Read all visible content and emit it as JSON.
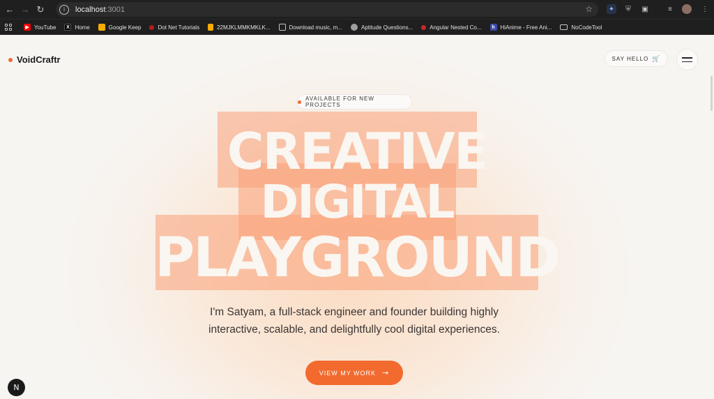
{
  "browser": {
    "url_host": "localhost",
    "url_port": ":3001",
    "bookmarks": [
      {
        "label": "YouTube",
        "icon": "youtube-icon",
        "color": "#ff0000"
      },
      {
        "label": "Home",
        "icon": "x-icon",
        "color": "#000000"
      },
      {
        "label": "Google Keep",
        "icon": "keep-icon",
        "color": "#f9ab00"
      },
      {
        "label": "Dot Net Tutorials",
        "icon": "dotnet-icon",
        "color": "#b71c1c"
      },
      {
        "label": "22MJKLMMKMKLK...",
        "icon": "file-icon",
        "color": "#f9ab00"
      },
      {
        "label": "Download music, m...",
        "icon": "music-icon",
        "color": "#9e9e9e"
      },
      {
        "label": "Aptitude Questions...",
        "icon": "brain-icon",
        "color": "#9e9e9e"
      },
      {
        "label": "Angular Nested Co...",
        "icon": "angular-icon",
        "color": "#c62828"
      },
      {
        "label": "HiAnime - Free Ani...",
        "icon": "anime-icon",
        "color": "#3949ab"
      },
      {
        "label": "NoCodeTool",
        "icon": "folder-icon",
        "color": "#c4c7c5"
      }
    ]
  },
  "site": {
    "brand": "VoidCraftr",
    "say_hello": "SAY HELLO",
    "badge": "AVAILABLE FOR NEW PROJECTS",
    "hero_line1": "CREATIVE",
    "hero_line2": "DIGITAL",
    "hero_line3": "PLAYGROUND",
    "subtitle": "I'm Satyam, a full-stack engineer and founder building highly interactive, scalable, and delightfully cool digital experiences.",
    "cta": "VIEW MY WORK",
    "accent_color": "#f26a2e"
  }
}
